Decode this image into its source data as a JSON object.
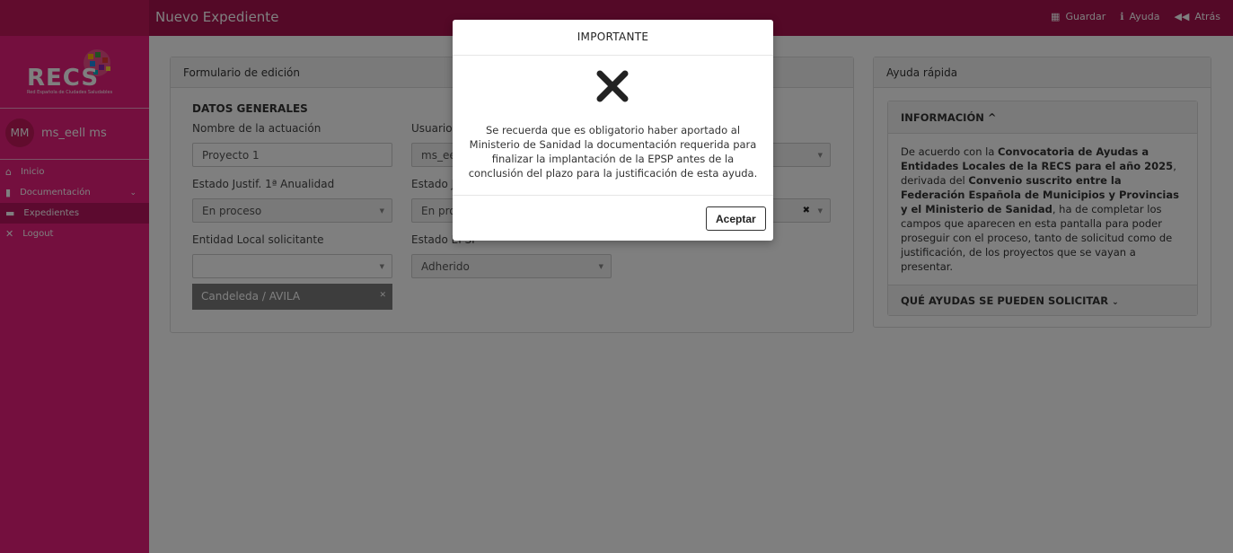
{
  "topbar": {
    "title": "Nuevo Expediente",
    "actions": {
      "save": "Guardar",
      "help": "Ayuda",
      "back": "Atrás"
    }
  },
  "sidebar": {
    "logo": "RECS",
    "logo_sub": "Red Española de Ciudades Saludables",
    "user": {
      "initials": "MM",
      "name": "ms_eell ms"
    },
    "items": [
      {
        "label": "Inicio",
        "icon": "home-icon"
      },
      {
        "label": "Documentación",
        "icon": "document-icon"
      },
      {
        "label": "Expedientes",
        "icon": "folder-icon"
      },
      {
        "label": "Logout",
        "icon": "close-icon"
      }
    ]
  },
  "form": {
    "title": "Formulario de edición",
    "section": "DATOS GENERALES",
    "fields": {
      "nombre_label": "Nombre de la actuación",
      "nombre_value": "Proyecto 1",
      "usuario_label": "Usuario",
      "usuario_value": "ms_ee",
      "estado1_label": "Estado Justif. 1ª Anualidad",
      "estado1_value": "En proceso",
      "estado2_label": "Estado J",
      "estado2_value": "En pro",
      "entidad_label": "Entidad Local solicitante",
      "entidad_value": "",
      "epsp_label": "Estado EPSP",
      "epsp_value": "Adherido",
      "tag": "Candeleda / AVILA"
    }
  },
  "help": {
    "title": "Ayuda rápida",
    "info_header": "INFORMACIÓN ^",
    "body_1": "De acuerdo con la ",
    "bold_1": "Convocatoria de Ayudas a Entidades Locales de la RECS para el año 2025",
    "body_2": ", derivada del ",
    "bold_2": "Convenio suscrito entre la Federación Española de Municipios y Provincias y el Ministerio de Sanidad",
    "body_3": ", ha de completar los campos que aparecen en esta pantalla para poder proseguir con el proceso, tanto de solicitud como de justificación, de los proyectos que se vayan a presentar.",
    "footer": "QUÉ AYUDAS SE PUEDEN SOLICITAR"
  },
  "modal": {
    "title": "IMPORTANTE",
    "message": "Se recuerda que es obligatorio haber aportado al Ministerio de Sanidad la documentación requerida para finalizar la implantación de la EPSP antes de la conclusión del plazo para la justificación de esta ayuda.",
    "accept": "Aceptar"
  },
  "colors": {
    "topbar": "#a8124f",
    "sidebar": "#e91e7d",
    "overlay": "rgba(0,0,0,0.5)"
  }
}
